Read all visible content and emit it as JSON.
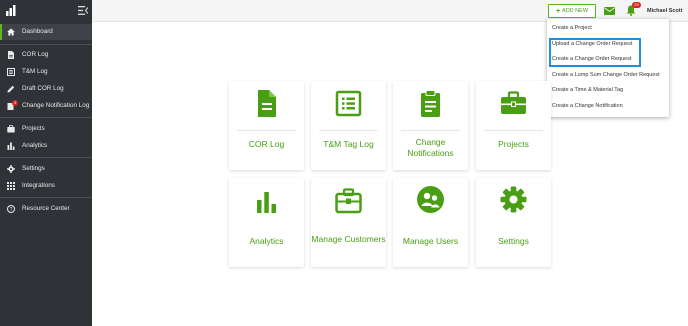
{
  "sidebar": {
    "items": [
      {
        "label": "Dashboard",
        "icon": "home-icon"
      },
      {
        "label": "COR Log",
        "icon": "document-icon"
      },
      {
        "label": "T&M Log",
        "icon": "list-icon"
      },
      {
        "label": "Draft COR Log",
        "icon": "edit-icon"
      },
      {
        "label": "Change Notification Log",
        "icon": "notification-log-icon",
        "badge": "3"
      },
      {
        "label": "Projects",
        "icon": "briefcase-icon"
      },
      {
        "label": "Analytics",
        "icon": "bar-chart-icon"
      },
      {
        "label": "Settings",
        "icon": "gear-icon"
      },
      {
        "label": "Integrations",
        "icon": "grid-icon"
      },
      {
        "label": "Resource Center",
        "icon": "help-icon"
      }
    ]
  },
  "topbar": {
    "add_new_label": "ADD NEW",
    "notification_count": "29",
    "user_name": "Michael Scott"
  },
  "dropdown": {
    "items": [
      "Create a Project",
      "Upload a Change Order Request",
      "Create a Change Order Request",
      "Create a Lump Sum Change Order Request",
      "Create a Time & Material Tag",
      "Create a Change Notification"
    ]
  },
  "tiles": [
    {
      "label": "COR Log",
      "icon": "document-icon"
    },
    {
      "label": "T&M Tag Log",
      "icon": "list-icon"
    },
    {
      "label": "Change Notifications",
      "icon": "clipboard-icon"
    },
    {
      "label": "Projects",
      "icon": "briefcase-icon"
    },
    {
      "label": "Analytics",
      "icon": "bar-chart-icon"
    },
    {
      "label": "Manage Customers",
      "icon": "briefcase-icon"
    },
    {
      "label": "Manage Users",
      "icon": "users-icon"
    },
    {
      "label": "Settings",
      "icon": "gear-icon"
    }
  ],
  "colors": {
    "brand_green": "#4a9e14",
    "sidebar_bg": "#2f3237",
    "highlight_blue": "#1e8fde",
    "badge_red": "#d9251c"
  }
}
